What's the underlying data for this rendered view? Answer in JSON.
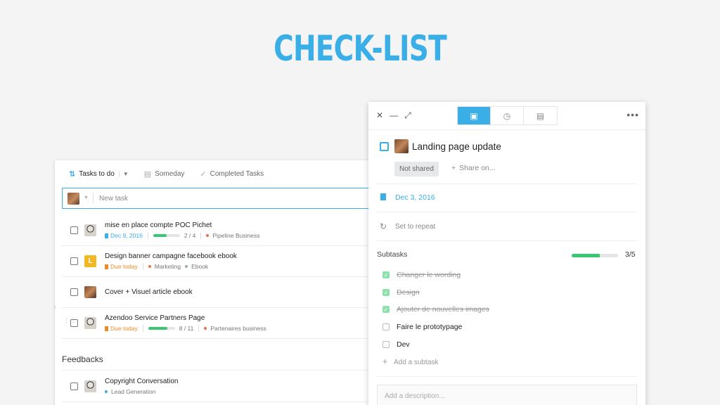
{
  "headline": "CHECK-LIST",
  "left": {
    "tabs": [
      {
        "label": "Tasks to do",
        "icon": "sort-arrows-icon"
      },
      {
        "label": "Someday",
        "icon": "archive-icon"
      },
      {
        "label": "Completed Tasks",
        "icon": "check-icon"
      }
    ],
    "new_task_placeholder": "New task",
    "tasks": [
      {
        "title": "mise en place compte POC Pichet",
        "date": "Dec 9, 2016",
        "progress": "2 / 4",
        "progress_fraction": 0.5,
        "tag": "Pipeline Business",
        "tag_color": "#e8734a"
      },
      {
        "title": "Design banner campagne facebook ebook",
        "due": "Due today",
        "tag": "Marketing",
        "tag_color": "#e8734a",
        "tag2": "Ebook",
        "tag2_color": "#9aa"
      },
      {
        "title": "Cover + Visuel article ebook"
      },
      {
        "title": "Azendoo Service Partners Page",
        "due": "Due today",
        "progress": "8 / 11",
        "progress_fraction": 0.73,
        "tag": "Partenaires business",
        "tag_color": "#e8734a"
      }
    ],
    "section_title": "Feedbacks",
    "feedback_task": {
      "title": "Copyright Conversation",
      "tag": "Lead Generation",
      "tag_color": "#3aaee6"
    }
  },
  "right": {
    "title": "Landing page update",
    "share_status": "Not shared",
    "share_on": "Share on...",
    "date": "Dec 3, 2016",
    "repeat": "Set to repeat",
    "subtasks_label": "Subtasks",
    "subtasks_count": "3/5",
    "subtasks_fraction": 0.6,
    "subtasks": [
      {
        "label": "Changer le wording",
        "done": true
      },
      {
        "label": "Design",
        "done": true
      },
      {
        "label": "Ajouter de nouvelles images",
        "done": true
      },
      {
        "label": "Faire le prototypage",
        "done": false
      },
      {
        "label": "Dev",
        "done": false
      }
    ],
    "add_subtask": "Add a subtask",
    "description_placeholder": "Add a description..."
  },
  "colors": {
    "accent": "#3aaee6",
    "due": "#f08a24",
    "progress": "#37c871"
  }
}
